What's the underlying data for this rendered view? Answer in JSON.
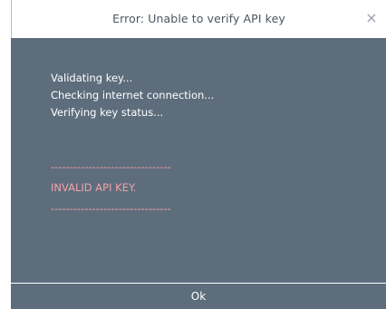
{
  "dialog": {
    "title": "Error: Unable to verify API key",
    "close_glyph": "×",
    "log_lines": [
      "Validating key...",
      "Checking internet connection...",
      "Verifying key status..."
    ],
    "error_separator": "--------------------------------",
    "error_message": "INVALID API KEY.",
    "ok_label": "Ok"
  },
  "colors": {
    "body_background": "#5d6d7c",
    "error_text": "#f3a2a7",
    "title_text": "#4b5560"
  },
  "icons": {
    "close": "close-icon"
  }
}
